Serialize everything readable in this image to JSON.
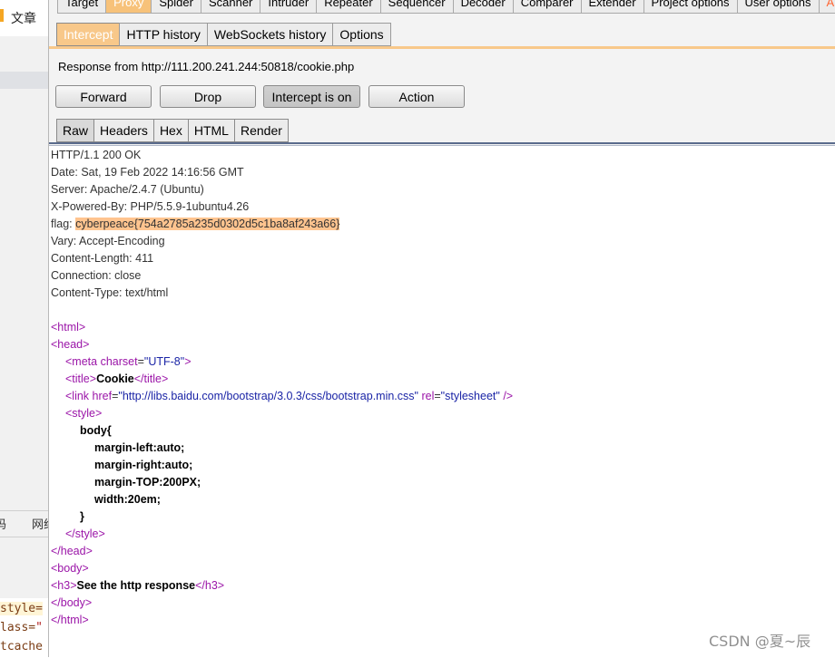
{
  "left_panel": {
    "top_text": "文章",
    "row_text_1": "码",
    "row_text_2": "网络",
    "code_lines": [
      {
        "before": "style=",
        "quote": ""
      },
      {
        "before": "lass=",
        "quote": "\""
      },
      {
        "before": "tcache",
        "quote": ""
      }
    ]
  },
  "top_tabs": [
    "Target",
    "Proxy",
    "Spider",
    "Scanner",
    "Intruder",
    "Repeater",
    "Sequencer",
    "Decoder",
    "Comparer",
    "Extender",
    "Project options",
    "User options",
    "Alerts"
  ],
  "active_top_tab": "Proxy",
  "sub_tabs": [
    "Intercept",
    "HTTP history",
    "WebSockets history",
    "Options"
  ],
  "active_sub_tab": "Intercept",
  "response_info": "Response from http://111.200.241.244:50818/cookie.php",
  "buttons": {
    "forward": "Forward",
    "drop": "Drop",
    "intercept": "Intercept is on",
    "action": "Action"
  },
  "view_tabs": [
    "Raw",
    "Headers",
    "Hex",
    "HTML",
    "Render"
  ],
  "active_view_tab": "Raw",
  "headers": [
    "HTTP/1.1 200 OK",
    "Date: Sat, 19 Feb 2022 14:16:56 GMT",
    "Server: Apache/2.4.7 (Ubuntu)",
    "X-Powered-By: PHP/5.5.9-1ubuntu4.26"
  ],
  "flag": {
    "name": "flag: ",
    "value": "cyberpeace{754a2785a235d0302d5c1ba8af243a66}"
  },
  "headers_after": [
    "Vary: Accept-Encoding",
    "Content-Length: 411",
    "Connection: close",
    "Content-Type: text/html"
  ],
  "body": {
    "html_open": "<html>",
    "head_open": "<head>",
    "meta_tag": "<meta",
    "meta_attr": "charset",
    "meta_val": "\"UTF-8\"",
    "meta_close": ">",
    "title_open": "<title>",
    "title_text": "Cookie",
    "title_close": "</title>",
    "link_tag": "<link",
    "link_href_attr": "href",
    "link_href_val": "\"http://libs.baidu.com/bootstrap/3.0.3/css/bootstrap.min.css\"",
    "link_rel_attr": "rel",
    "link_rel_val": "\"stylesheet\"",
    "link_close": "/>",
    "style_open": "<style>",
    "css_selector": "body{",
    "css_rules": [
      "margin-left:auto;",
      "margin-right:auto;",
      "margin-TOP:200PX;",
      "width:20em;"
    ],
    "css_close": "}",
    "style_close": "</style>",
    "head_close": "</head>",
    "body_open": "<body>",
    "h3_open": "<h3>",
    "h3_text": "See the http response",
    "h3_close": "</h3>",
    "body_close": "</body>",
    "html_close": "</html>"
  },
  "watermark": "CSDN @夏~辰",
  "colors": {
    "active_tab": "#f7c27a",
    "flag_highlight": "#ffc48f",
    "tag": "#9b15a8",
    "attr_value": "#1a24a6"
  }
}
